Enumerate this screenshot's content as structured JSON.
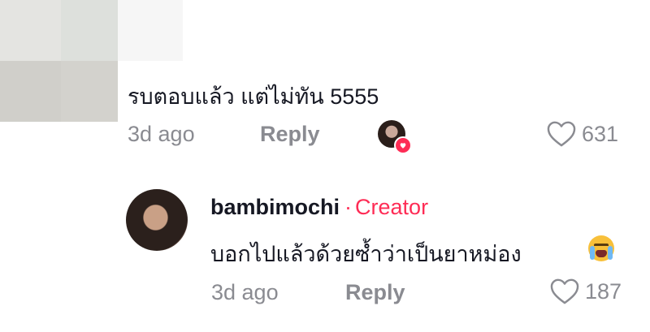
{
  "comment1": {
    "text": "รบตอบแล้ว แต่ไม่ทัน 5555",
    "time": "3d ago",
    "reply_label": "Reply",
    "likes": "631"
  },
  "comment2": {
    "username": "bambimochi",
    "separator": "·",
    "badge": "Creator",
    "text": "บอกไปแล้วด้วยซ้ำว่าเป็นยาหม่อง",
    "emoji": "loudly-crying-face",
    "time": "3d ago",
    "reply_label": "Reply",
    "likes": "187"
  },
  "colors": {
    "accent": "#fe2c55",
    "text": "#161823",
    "muted": "#8a8b91"
  }
}
